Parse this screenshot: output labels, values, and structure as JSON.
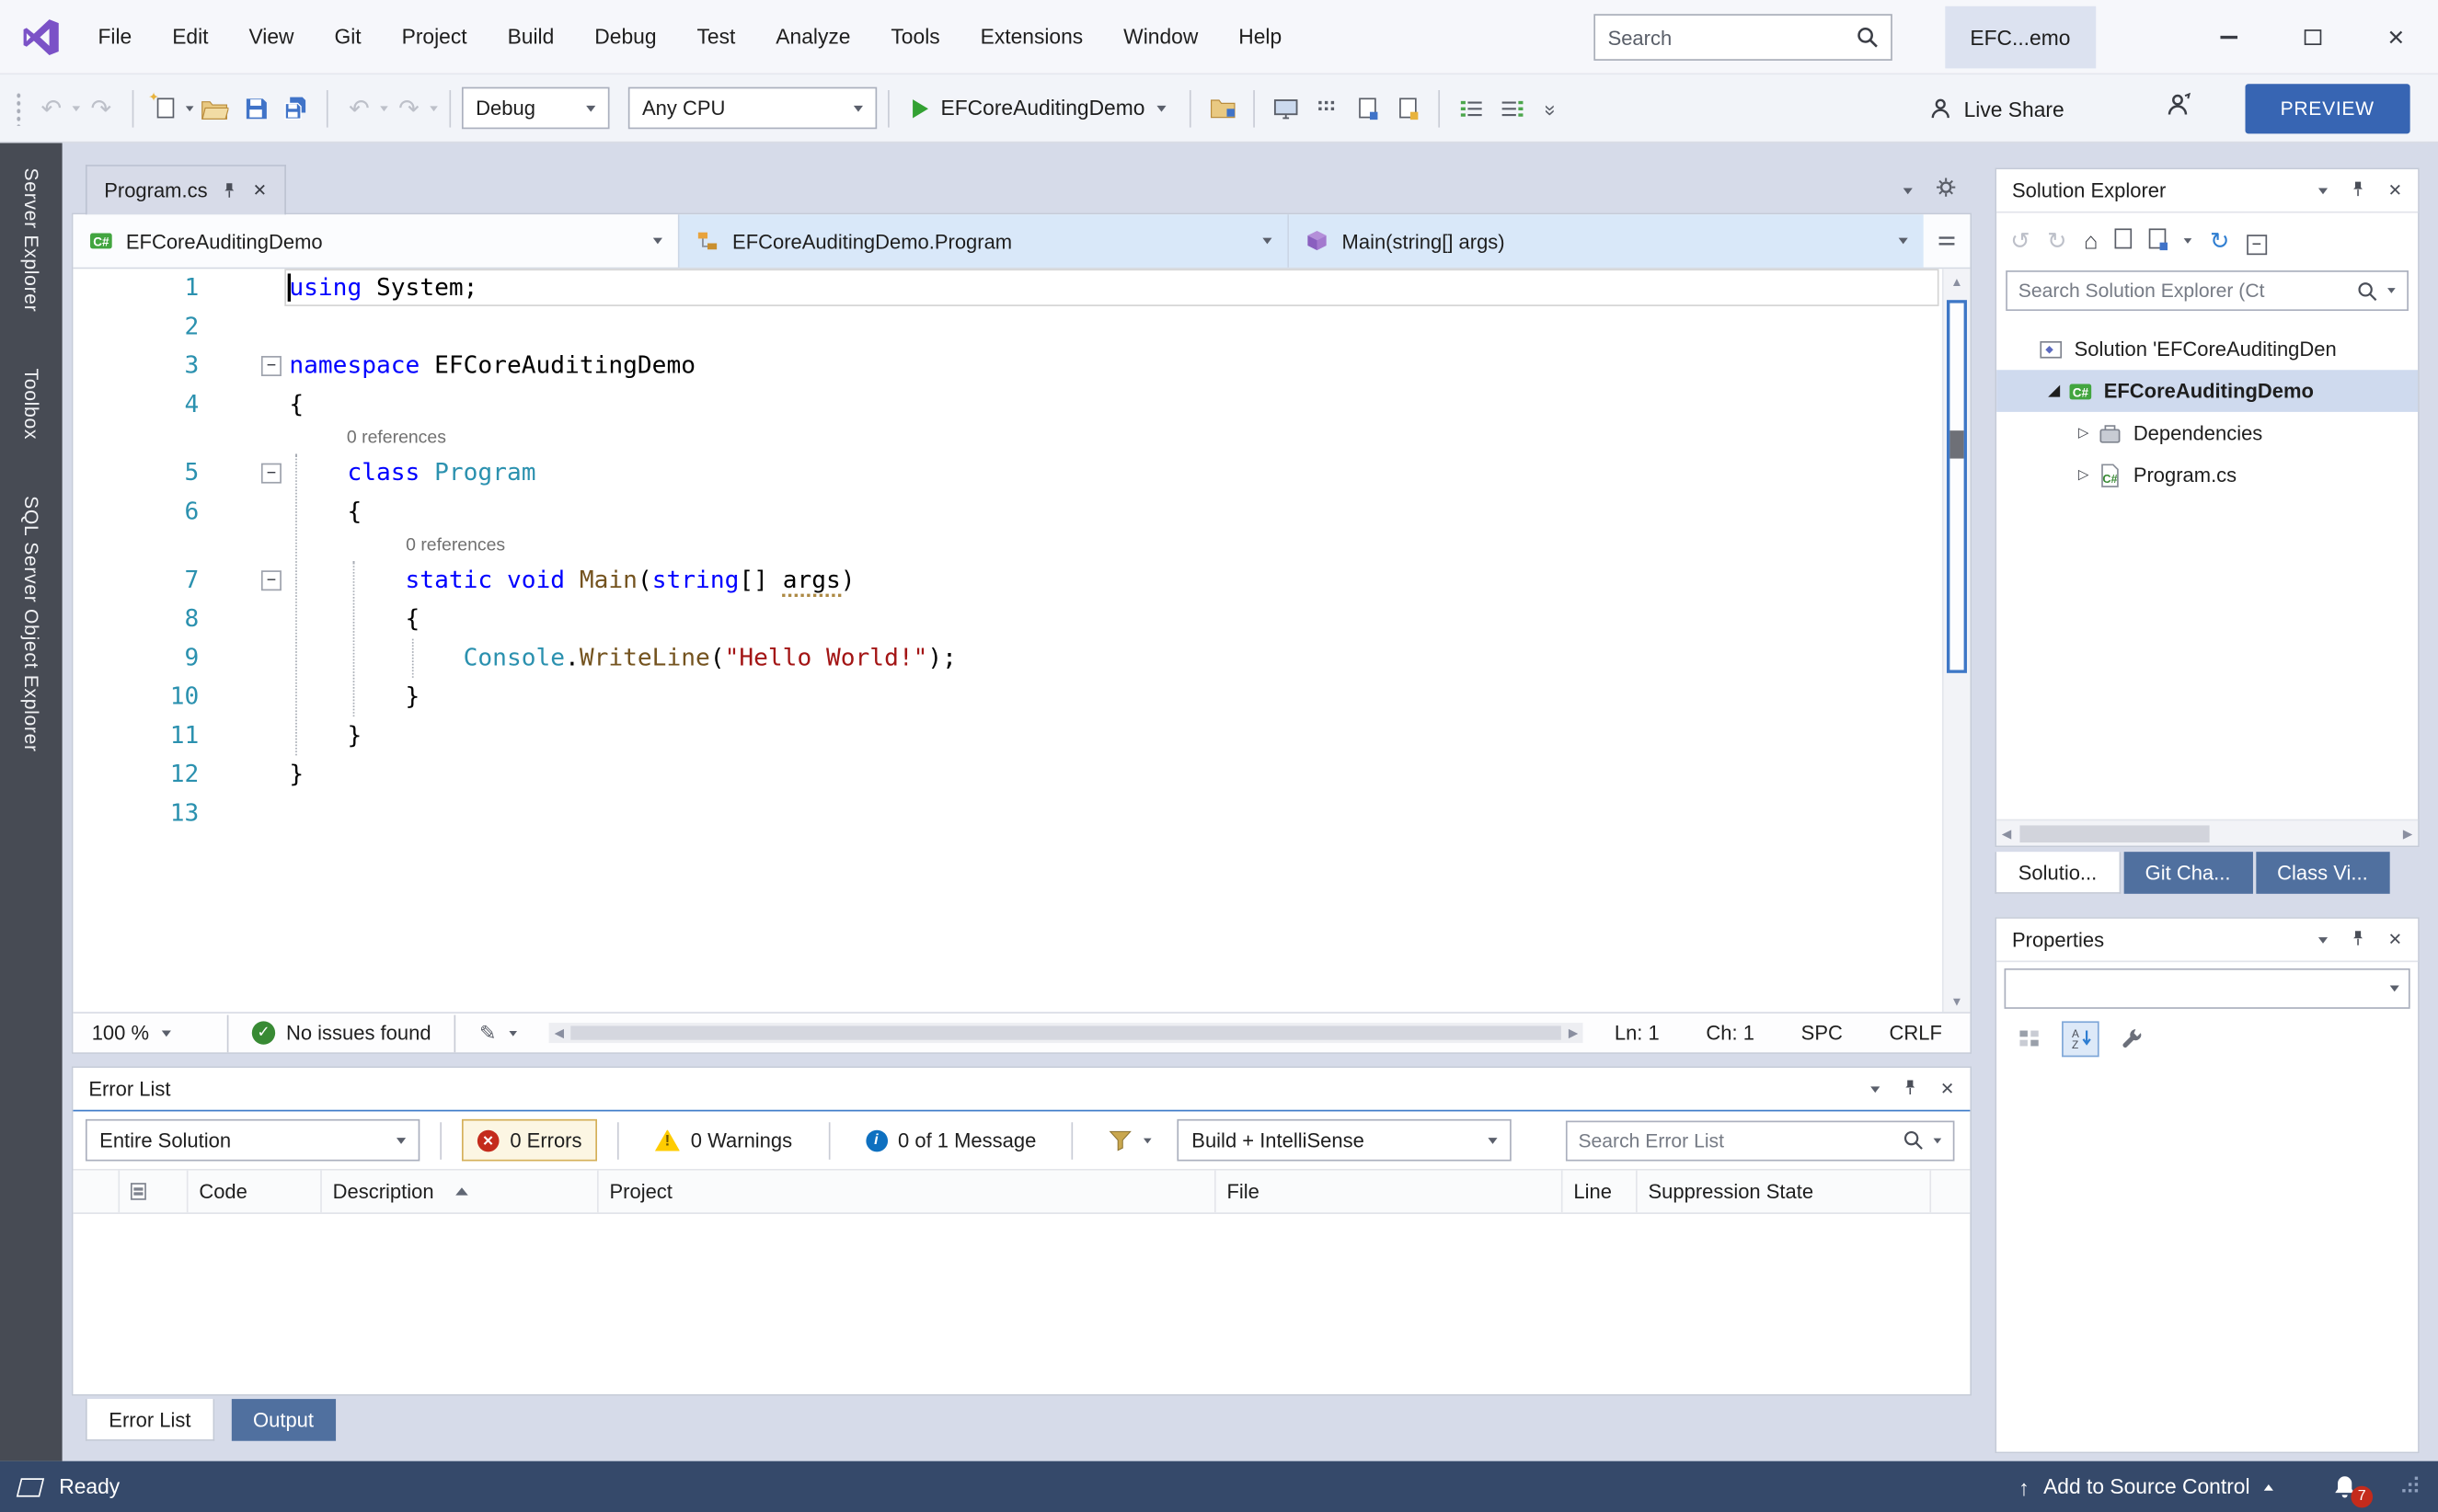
{
  "titlebar": {
    "menus": [
      "File",
      "Edit",
      "View",
      "Git",
      "Project",
      "Build",
      "Debug",
      "Test",
      "Analyze",
      "Tools",
      "Extensions",
      "Window",
      "Help"
    ],
    "search_placeholder": "Search",
    "window_title": "EFC...emo"
  },
  "toolbar": {
    "configuration": "Debug",
    "platform": "Any CPU",
    "start_button": "EFCoreAuditingDemo",
    "live_share": "Live Share",
    "preview": "PREVIEW"
  },
  "left_dock": [
    "Server Explorer",
    "Toolbox",
    "SQL Server Object Explorer"
  ],
  "editor": {
    "tab": "Program.cs",
    "navbar": {
      "project": "EFCoreAuditingDemo",
      "type": "EFCoreAuditingDemo.Program",
      "member": "Main(string[] args)"
    },
    "token_colors": {
      "kw": "#0000FF",
      "ty": "#2B91AF",
      "me": "#74531F",
      "st": "#A31515",
      "pl": "#000000"
    },
    "code_lines": [
      {
        "n": "1",
        "caret": true,
        "current": true,
        "tokens": [
          [
            "using",
            "kw"
          ],
          [
            " System;",
            "pl"
          ]
        ]
      },
      {
        "n": "2",
        "tokens": []
      },
      {
        "n": "3",
        "fold": true,
        "tokens": [
          [
            "namespace",
            "kw"
          ],
          [
            " EFCoreAuditingDemo",
            "pl"
          ]
        ]
      },
      {
        "n": "4",
        "tokens": [
          [
            "{",
            "pl"
          ]
        ]
      },
      {
        "lens": "0 references",
        "col": 4
      },
      {
        "n": "5",
        "fold": true,
        "tokens": [
          [
            "    ",
            "pl"
          ],
          [
            "class",
            "kw"
          ],
          [
            " ",
            "pl"
          ],
          [
            "Program",
            "ty"
          ]
        ]
      },
      {
        "n": "6",
        "tokens": [
          [
            "    {",
            "pl"
          ]
        ]
      },
      {
        "lens": "0 references",
        "col": 8
      },
      {
        "n": "7",
        "fold": true,
        "tokens": [
          [
            "        ",
            "pl"
          ],
          [
            "static",
            "kw"
          ],
          [
            " ",
            "pl"
          ],
          [
            "void",
            "kw"
          ],
          [
            " ",
            "pl"
          ],
          [
            "Main",
            "me"
          ],
          [
            "(",
            "pl"
          ],
          [
            "string",
            "kw"
          ],
          [
            "[] ",
            "pl"
          ],
          [
            "args",
            "pl",
            "u"
          ],
          [
            ")",
            "pl"
          ]
        ]
      },
      {
        "n": "8",
        "tokens": [
          [
            "        {",
            "pl"
          ]
        ]
      },
      {
        "n": "9",
        "tokens": [
          [
            "            ",
            "pl"
          ],
          [
            "Console",
            "ty"
          ],
          [
            ".",
            "pl"
          ],
          [
            "WriteLine",
            "me"
          ],
          [
            "(",
            "pl"
          ],
          [
            "\"Hello World!\"",
            "st"
          ],
          [
            ");",
            "pl"
          ]
        ]
      },
      {
        "n": "10",
        "tokens": [
          [
            "        }",
            "pl"
          ]
        ]
      },
      {
        "n": "11",
        "tokens": [
          [
            "    }",
            "pl"
          ]
        ]
      },
      {
        "n": "12",
        "tokens": [
          [
            "}",
            "pl"
          ]
        ]
      },
      {
        "n": "13",
        "tokens": []
      }
    ],
    "status": {
      "zoom": "100 %",
      "issues": "No issues found",
      "line": "Ln: 1",
      "column": "Ch: 1",
      "insert_mode": "SPC",
      "line_ending": "CRLF"
    }
  },
  "error_list": {
    "title": "Error List",
    "scope": "Entire Solution",
    "errors": "0 Errors",
    "warnings": "0 Warnings",
    "messages": "0 of 1 Message",
    "source_filter": "Build + IntelliSense",
    "search_placeholder": "Search Error List",
    "columns": [
      "Code",
      "Description",
      "Project",
      "File",
      "Line",
      "Suppression State"
    ],
    "sorted_column": "Description",
    "rows": []
  },
  "panel_tabs": [
    {
      "label": "Error List",
      "active": true
    },
    {
      "label": "Output",
      "active": false
    }
  ],
  "solution_explorer": {
    "title": "Solution Explorer",
    "search_placeholder": "Search Solution Explorer (Ct",
    "tree": [
      {
        "label": "Solution 'EFCoreAuditingDen",
        "icon": "solution",
        "indent": 0,
        "expander": "none",
        "selected": false,
        "bold": false
      },
      {
        "label": "EFCoreAuditingDemo",
        "icon": "csharp-project",
        "indent": 1,
        "expander": "expanded",
        "selected": true,
        "bold": true
      },
      {
        "label": "Dependencies",
        "icon": "dependencies",
        "indent": 2,
        "expander": "collapsed",
        "selected": false,
        "bold": false
      },
      {
        "label": "Program.cs",
        "icon": "csharp-file",
        "indent": 2,
        "expander": "collapsed",
        "selected": false,
        "bold": false
      }
    ],
    "tabs": [
      {
        "label": "Solutio...",
        "active": true
      },
      {
        "label": "Git Cha...",
        "active": false
      },
      {
        "label": "Class Vi...",
        "active": false
      }
    ]
  },
  "properties": {
    "title": "Properties"
  },
  "status_bar": {
    "ready": "Ready",
    "add_to_source_control": "Add to Source Control",
    "notification_count": "7"
  },
  "colors": {
    "accent": "#3E6DB5",
    "status_bar": "#35496A",
    "selection": "#CFDAEE",
    "error": "#C42B1C",
    "warning": "#FFCC00",
    "info": "#0E70C0",
    "keyword": "#0000FF",
    "type": "#2B91AF",
    "method": "#74531F",
    "string": "#A31515",
    "line_number": "#2B91AF"
  },
  "icons": {
    "vs-logo": "purple infinity mark",
    "magnifier": "search",
    "pin": "thumbtack",
    "close": "✕",
    "play": "green triangle",
    "save": "blue floppy",
    "folder-open": "yellow folder",
    "error": "red circle x",
    "warning": "yellow triangle !",
    "info": "blue circle i",
    "bell": "notifications",
    "check": "green circle check"
  }
}
